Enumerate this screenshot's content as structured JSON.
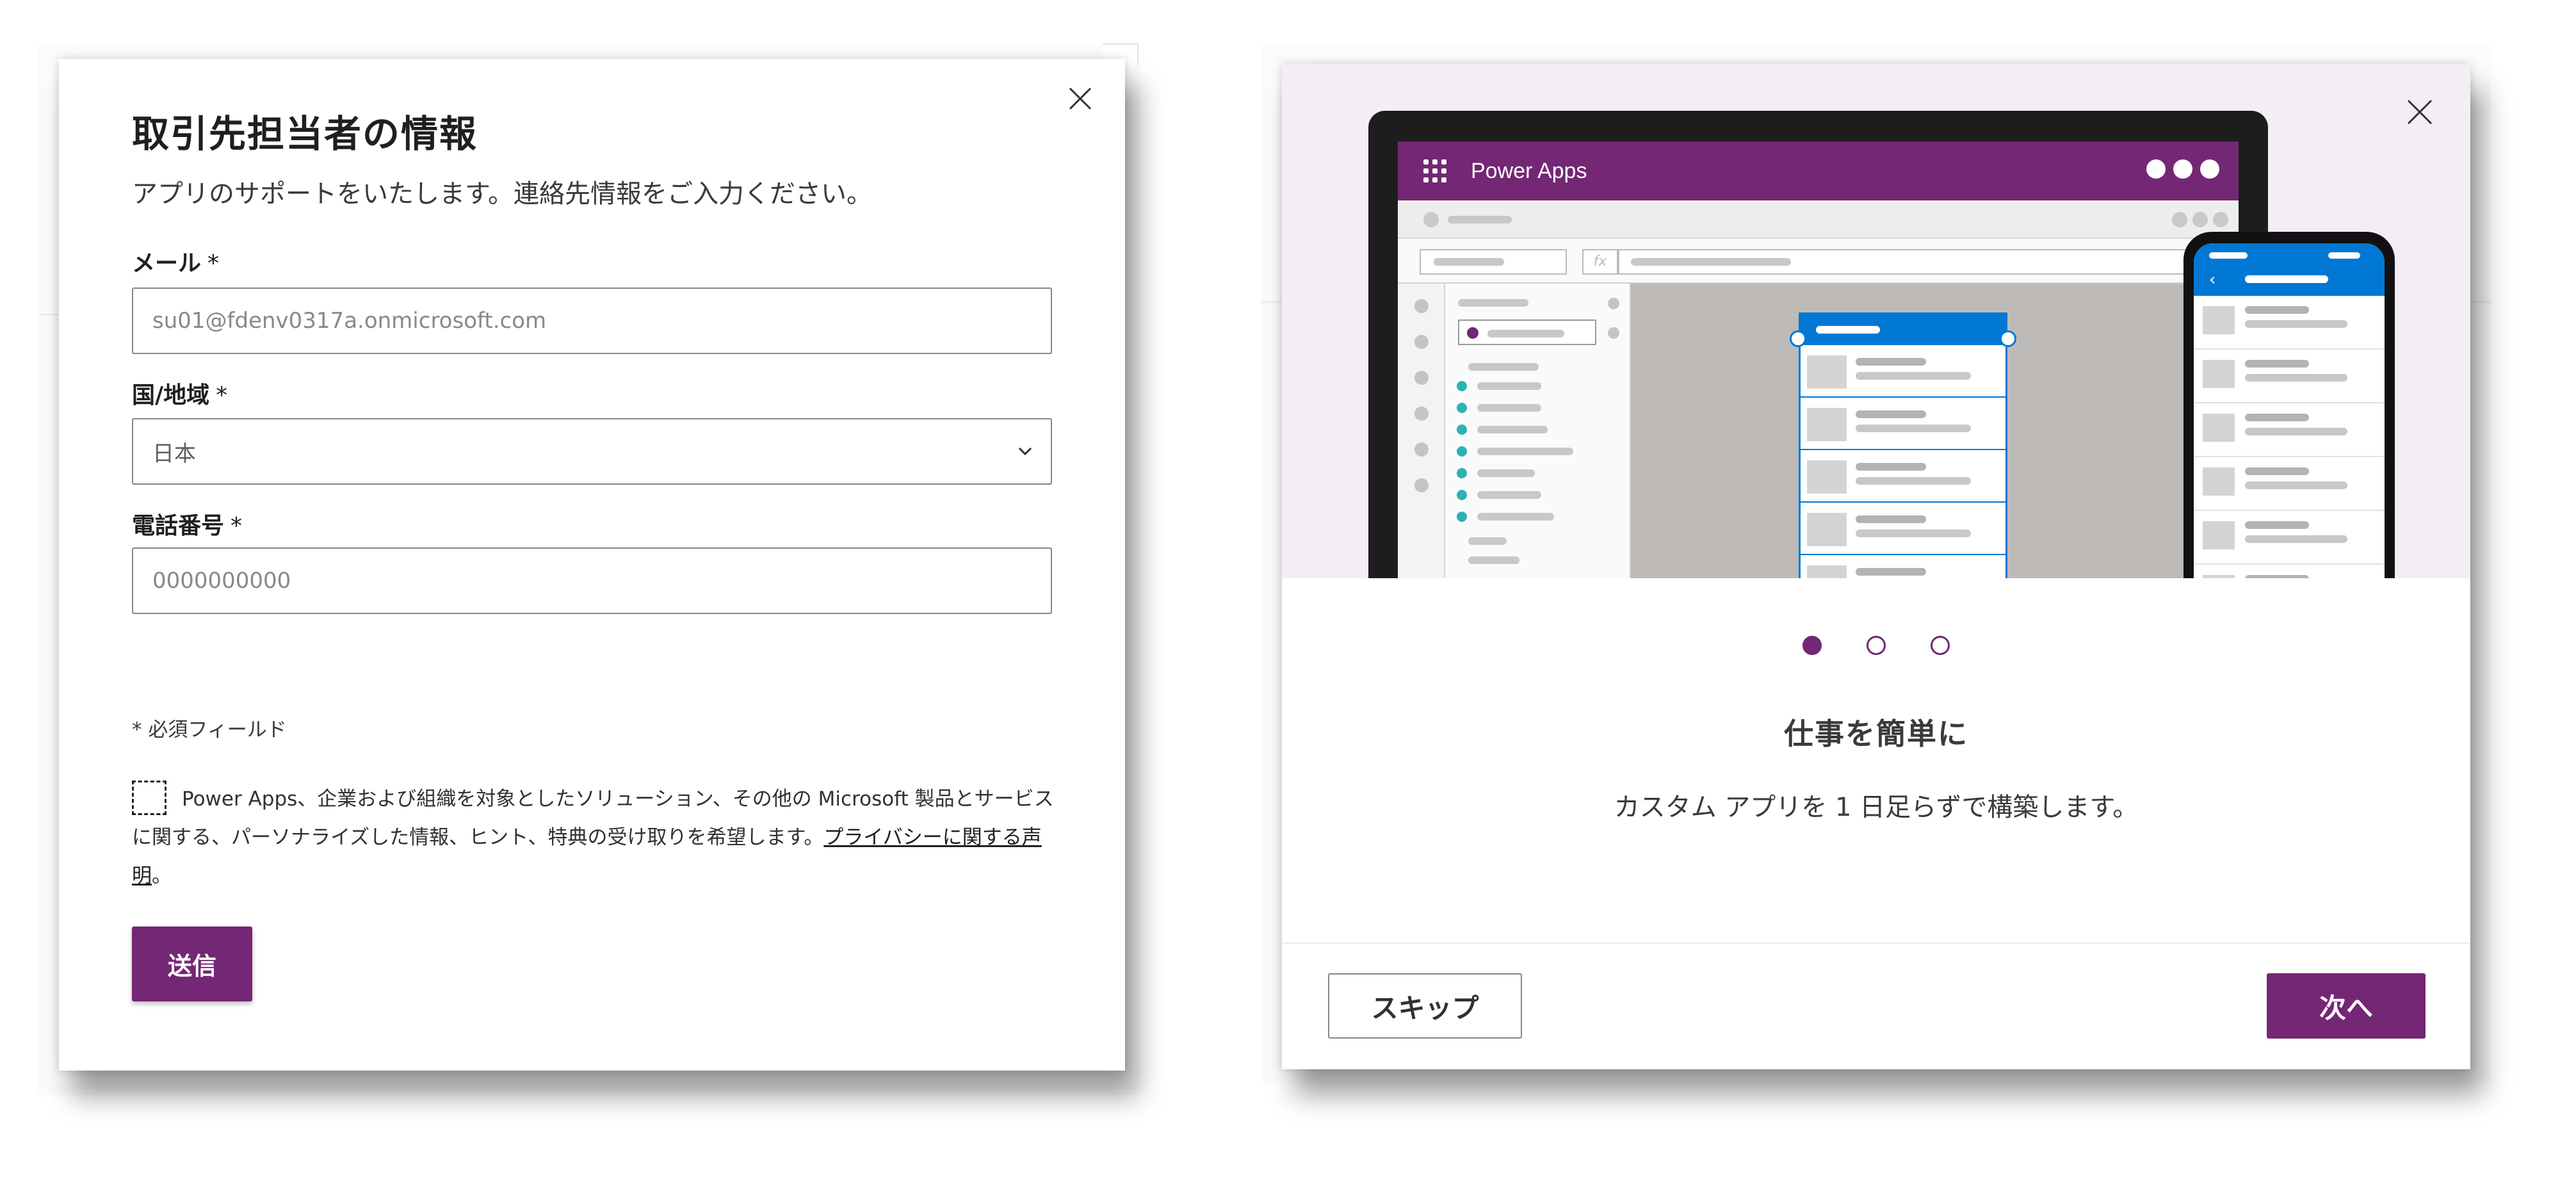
{
  "contact_dialog": {
    "title": "取引先担当者の情報",
    "subtitle": "アプリのサポートをいたします。連絡先情報をご入力ください。",
    "email": {
      "label": "メール",
      "required_mark": "*",
      "placeholder": "su01@fdenv0317a.onmicrosoft.com"
    },
    "country": {
      "label": "国/地域",
      "required_mark": "*",
      "selected": "日本"
    },
    "phone": {
      "label": "電話番号",
      "required_mark": "*",
      "placeholder": "0000000000"
    },
    "required_note": "* 必須フィールド",
    "consent": {
      "checked": false,
      "text": "Power Apps、企業および組織を対象としたソリューション、その他の Microsoft 製品とサービスに関する、パーソナライズした情報、ヒント、特典の受け取りを希望します。",
      "link_text": "プライバシーに関する声明",
      "suffix": "。"
    },
    "submit_label": "送信"
  },
  "welcome_dialog": {
    "illustration": {
      "app_name": "Power Apps"
    },
    "pager": {
      "total": 3,
      "active_index": 0
    },
    "slide_title": "仕事を簡単に",
    "slide_description": "カスタム アプリを 1 日足らずで構築します。",
    "skip_label": "スキップ",
    "next_label": "次へ"
  },
  "colors": {
    "brand_purple": "#742774",
    "hero_background": "#f4edf6",
    "accent_blue": "#0078d4",
    "teal_dot": "#2bb3b1"
  }
}
